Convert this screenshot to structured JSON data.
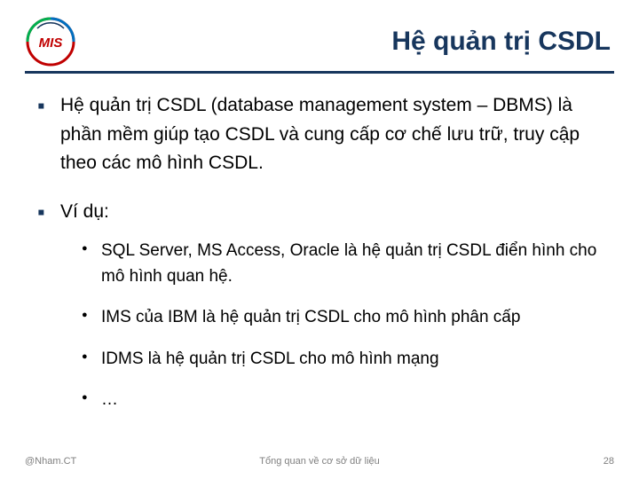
{
  "header": {
    "title": "Hệ quản trị CSDL",
    "logo_text": "MIS"
  },
  "bullets": [
    {
      "text": "Hệ quản trị CSDL (database management system – DBMS) là phần mềm giúp tạo CSDL và cung cấp cơ chế lưu trữ, truy cập theo các mô hình CSDL."
    },
    {
      "text": "Ví dụ:",
      "sub": [
        "SQL Server, MS Access, Oracle là hệ quản trị CSDL điển hình cho mô hình quan hệ.",
        "IMS của IBM là hệ quản trị CSDL cho mô hình phân cấp",
        "IDMS là hệ quản trị CSDL cho mô hình mạng",
        "…"
      ]
    }
  ],
  "footer": {
    "left": "@Nham.CT",
    "center": "Tổng quan về cơ sở dữ liệu",
    "page": "28"
  }
}
